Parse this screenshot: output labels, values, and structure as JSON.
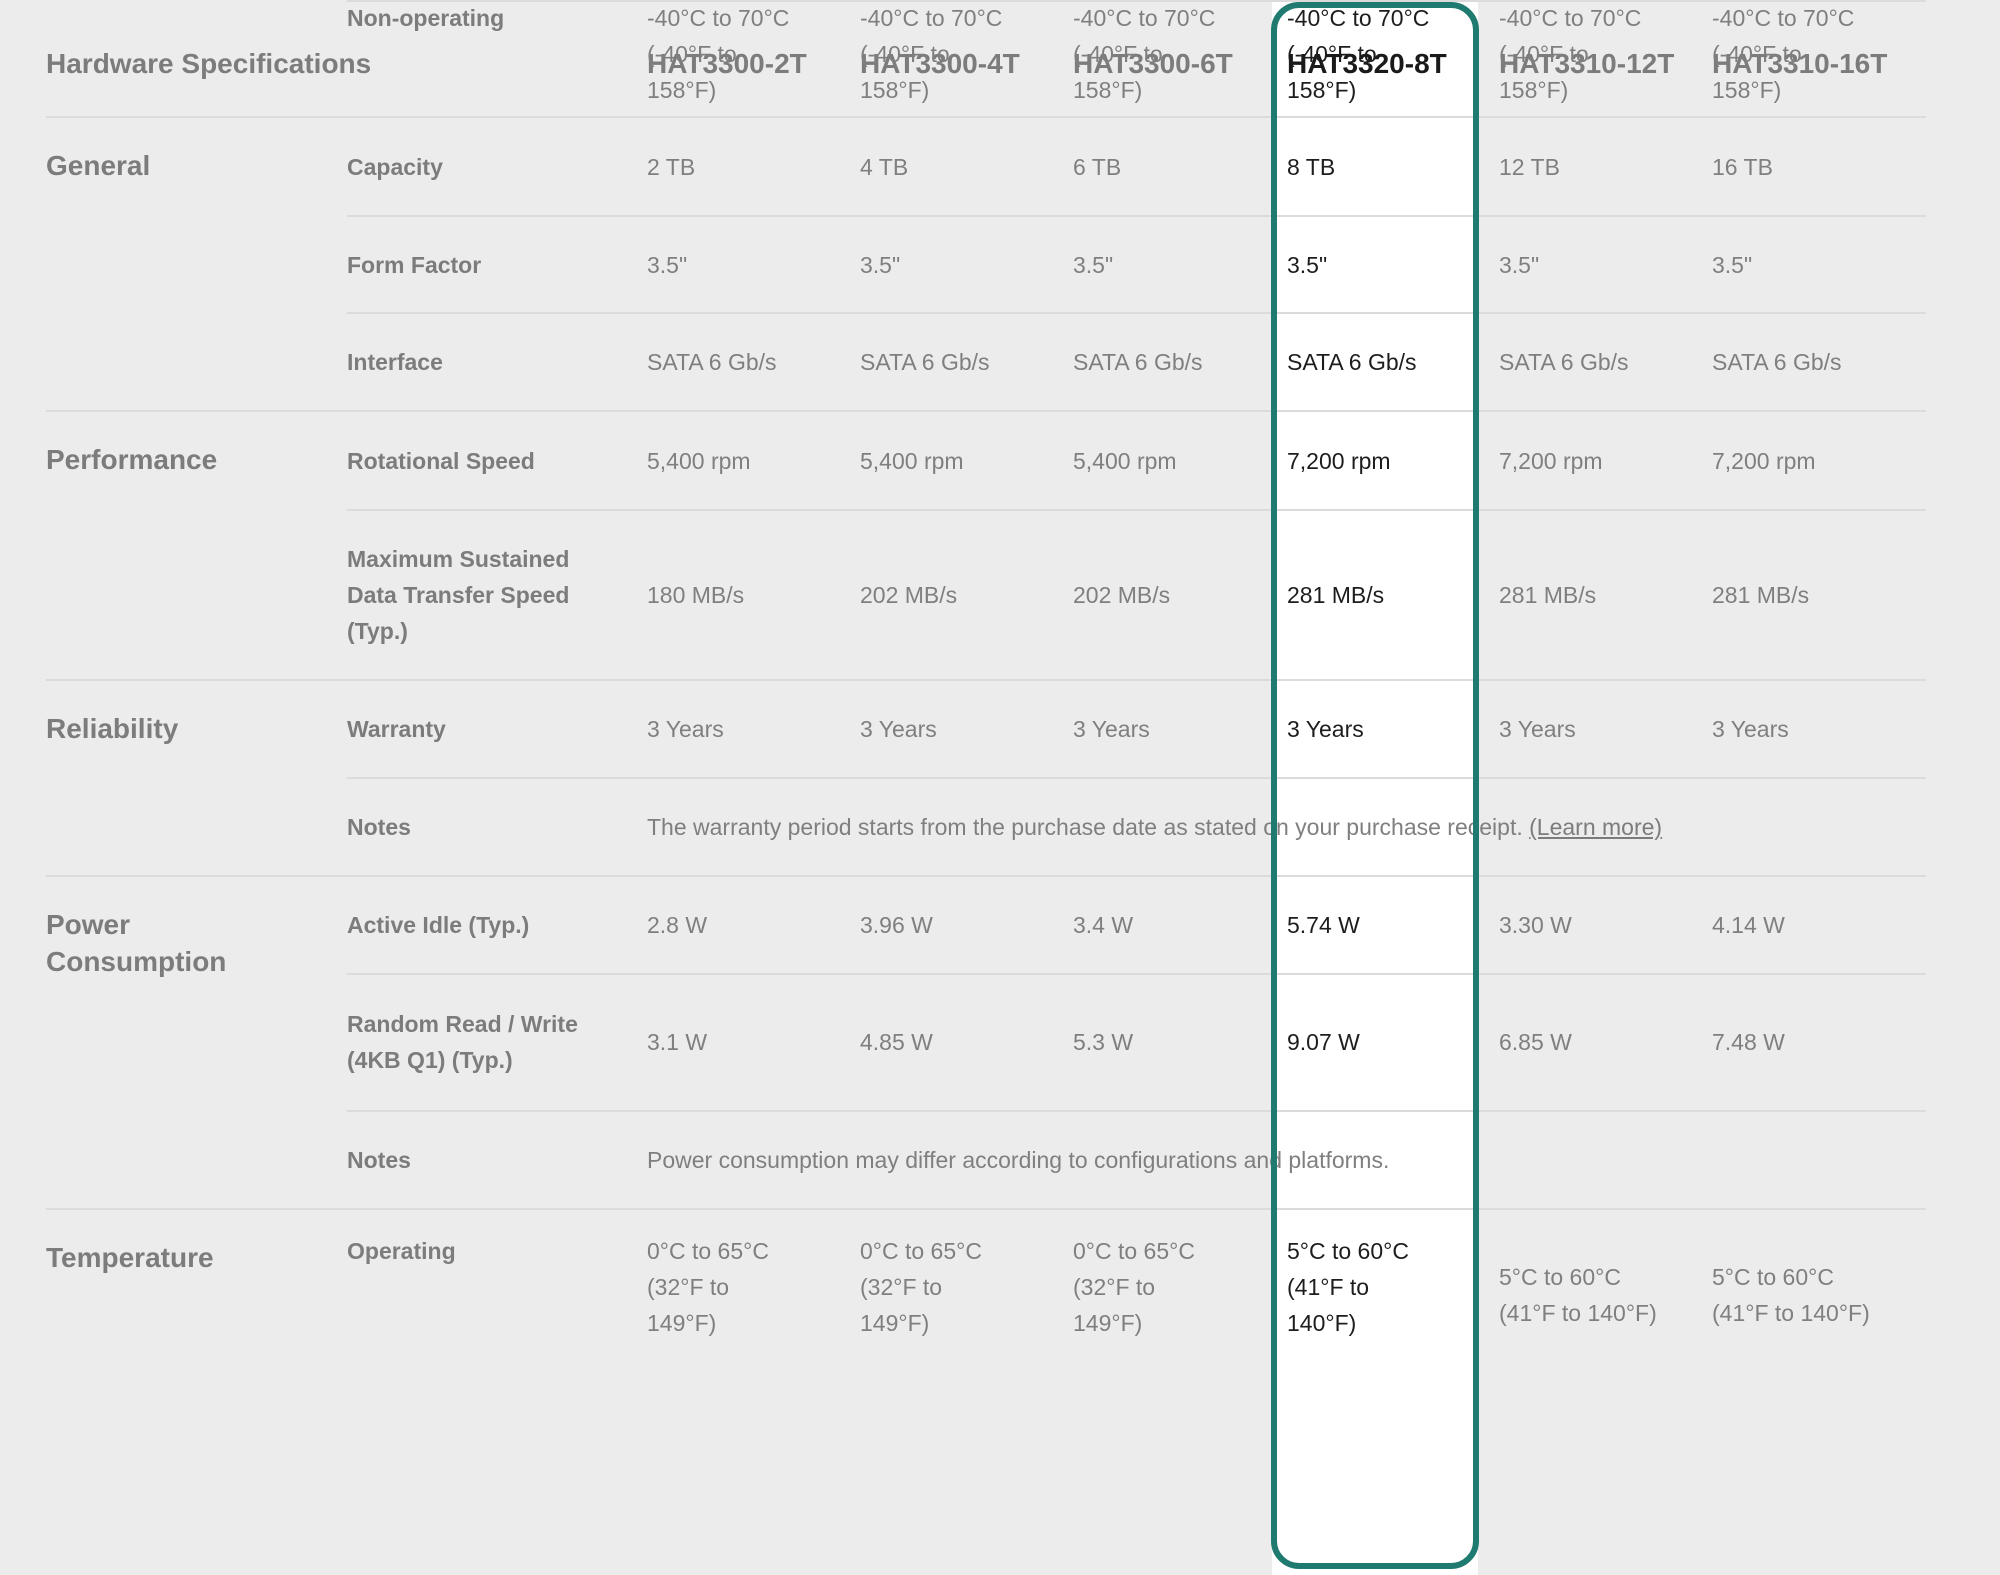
{
  "table": {
    "title": "Hardware Specifications",
    "highlight_color": "#1f7a70",
    "highlighted_model": "HAT3320-8T",
    "models": [
      "HAT3300-2T",
      "HAT3300-4T",
      "HAT3300-6T",
      "HAT3320-8T",
      "HAT3310-12T",
      "HAT3310-16T"
    ],
    "groups": [
      {
        "name": "General",
        "rows": [
          {
            "label": "Capacity",
            "values": [
              "2 TB",
              "4 TB",
              "6 TB",
              "8 TB",
              "12 TB",
              "16 TB"
            ]
          },
          {
            "label": "Form Factor",
            "values": [
              "3.5\"",
              "3.5\"",
              "3.5\"",
              "3.5\"",
              "3.5\"",
              "3.5\""
            ]
          },
          {
            "label": "Interface",
            "values": [
              "SATA 6 Gb/s",
              "SATA 6 Gb/s",
              "SATA 6 Gb/s",
              "SATA 6 Gb/s",
              "SATA 6 Gb/s",
              "SATA 6 Gb/s"
            ]
          }
        ]
      },
      {
        "name": "Performance",
        "rows": [
          {
            "label": "Rotational Speed",
            "values": [
              "5,400 rpm",
              "5,400 rpm",
              "5,400 rpm",
              "7,200 rpm",
              "7,200 rpm",
              "7,200 rpm"
            ]
          },
          {
            "label": "Maximum Sustained\nData Transfer Speed\n(Typ.)",
            "values": [
              "180 MB/s",
              "202 MB/s",
              "202 MB/s",
              "281 MB/s",
              "281 MB/s",
              "281 MB/s"
            ]
          }
        ]
      },
      {
        "name": "Reliability",
        "rows": [
          {
            "label": "Warranty",
            "values": [
              "3 Years",
              "3 Years",
              "3 Years",
              "3 Years",
              "3 Years",
              "3 Years"
            ]
          },
          {
            "label": "Notes",
            "note": "The warranty period starts from the purchase date as stated on your purchase receipt.",
            "link": "(Learn more)"
          }
        ]
      },
      {
        "name": "Power\nConsumption",
        "rows": [
          {
            "label": "Active Idle (Typ.)",
            "values": [
              "2.8 W",
              "3.96 W",
              "3.4 W",
              "5.74 W",
              "3.30 W",
              "4.14 W"
            ]
          },
          {
            "label": "Random Read / Write\n(4KB Q1) (Typ.)",
            "values": [
              "3.1 W",
              "4.85 W",
              "5.3 W",
              "9.07 W",
              "6.85 W",
              "7.48 W"
            ]
          },
          {
            "label": "Notes",
            "note": "Power consumption may differ according to configurations and platforms."
          }
        ]
      },
      {
        "name": "Temperature",
        "rows": [
          {
            "label": "Operating",
            "values": [
              "0°C to 65°C\n(32°F to\n149°F)",
              "0°C to 65°C\n(32°F to\n149°F)",
              "0°C to 65°C\n(32°F to\n149°F)",
              " 5°C to 60°C\n(41°F to\n140°F)",
              "5°C to 60°C\n(41°F to 140°F)",
              "5°C to 60°C\n(41°F to 140°F)"
            ]
          },
          {
            "label": "Non-operating",
            "values": [
              "-40°C to 70°C\n(-40°F to\n158°F)",
              "-40°C to 70°C\n(-40°F to\n158°F)",
              "-40°C to 70°C\n(-40°F to\n158°F)",
              "-40°C to 70°C\n(-40°F to\n158°F)",
              "-40°C to 70°C\n(-40°F to\n158°F)",
              "-40°C to 70°C\n(-40°F to\n158°F)"
            ]
          }
        ]
      }
    ]
  }
}
